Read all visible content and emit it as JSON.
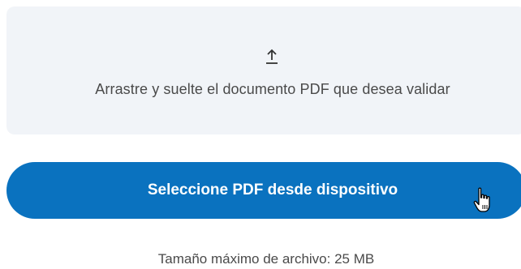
{
  "dropzone": {
    "icon": "upload-arrow-icon",
    "text": "Arrastre y suelte el documento PDF que desea validar"
  },
  "select_button": {
    "label": "Seleccione PDF desde dispositivo"
  },
  "size_note": "Tamaño máximo de archivo: 25 MB",
  "cursor": "hand-pointer-icon",
  "colors": {
    "dropzone_bg": "#f1f4f8",
    "button_bg": "#0a72bf",
    "text": "#4a4a4a"
  }
}
